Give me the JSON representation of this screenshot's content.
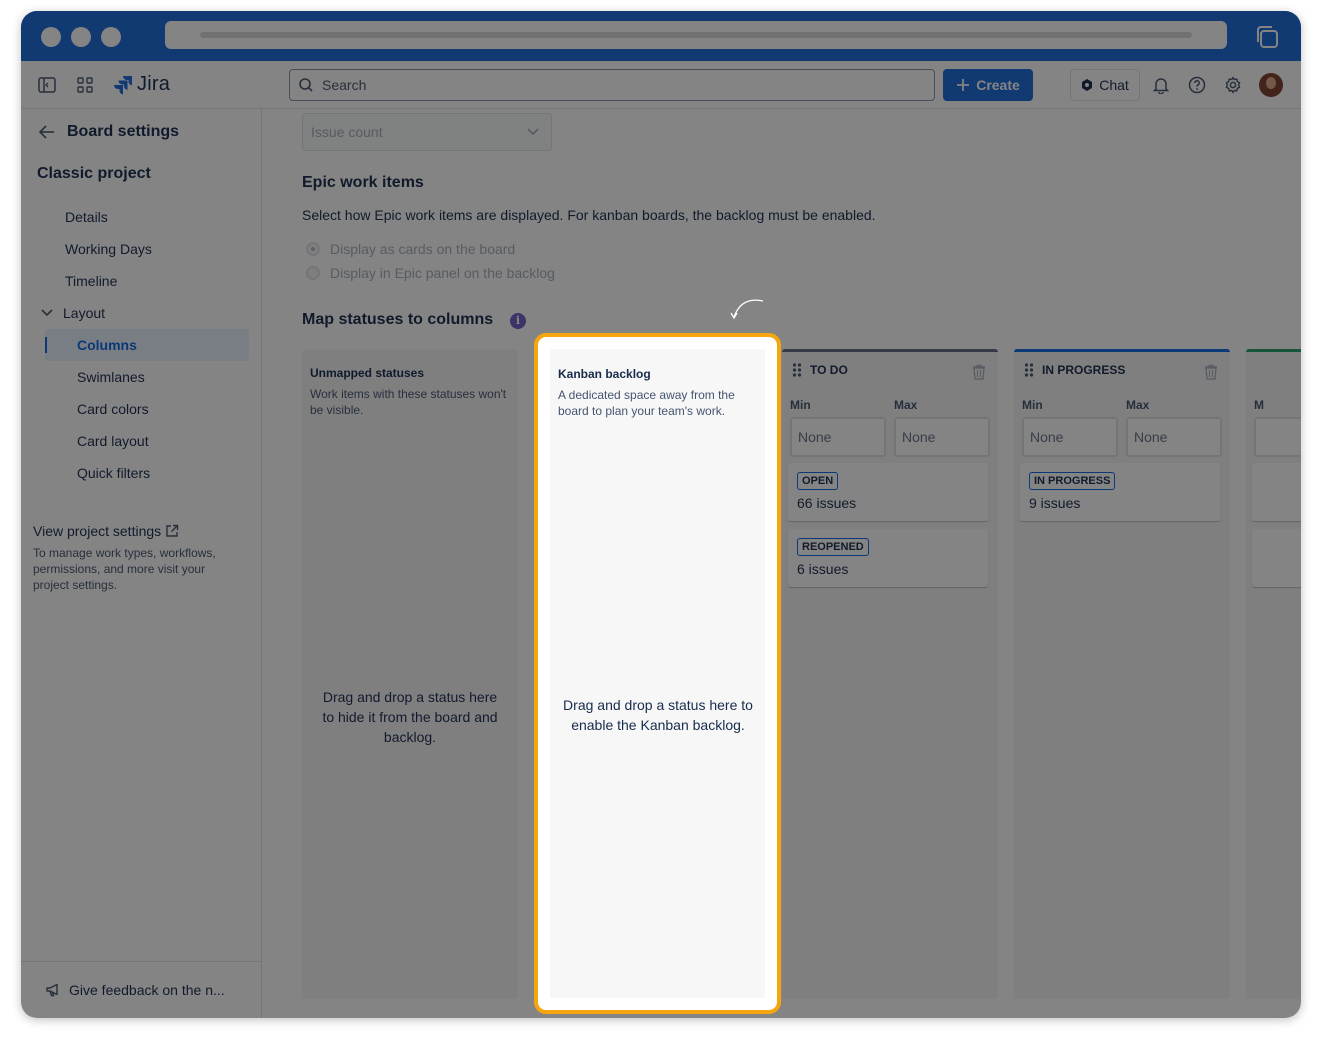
{
  "app": {
    "name": "Jira"
  },
  "topnav": {
    "search_placeholder": "Search",
    "create_label": "Create",
    "chat_label": "Chat"
  },
  "sidebar": {
    "back_label": "Board settings",
    "project_name": "Classic project",
    "items": [
      {
        "label": "Details"
      },
      {
        "label": "Working Days"
      },
      {
        "label": "Timeline"
      },
      {
        "label": "Layout"
      },
      {
        "label": "Columns"
      },
      {
        "label": "Swimlanes"
      },
      {
        "label": "Card colors"
      },
      {
        "label": "Card layout"
      },
      {
        "label": "Quick filters"
      }
    ],
    "view_settings_label": "View project settings",
    "view_settings_desc": "To manage work types, workflows, permissions, and more visit your project settings.",
    "feedback_label": "Give feedback on the n..."
  },
  "main": {
    "select_value": "Issue count",
    "epic_title": "Epic work items",
    "epic_desc": "Select how Epic work items are displayed. For kanban boards, the backlog must be enabled.",
    "radio_options": [
      {
        "label": "Display as cards on the board",
        "selected": true
      },
      {
        "label": "Display in Epic panel on the backlog",
        "selected": false
      }
    ],
    "map_title": "Map statuses to columns",
    "info_glyph": "i",
    "unmapped": {
      "title": "Unmapped statuses",
      "desc": "Work items with these statuses won't be visible.",
      "hint": "Drag and drop a status here to hide it from the board and backlog."
    },
    "kanban": {
      "title": "Kanban backlog",
      "desc": "A dedicated space away from the board to plan your team's work.",
      "hint": "Drag and drop a status here to enable the Kanban backlog."
    },
    "min_label": "Min",
    "max_label": "Max",
    "columns": [
      {
        "name": "TO DO",
        "color": "#5e6c84",
        "min": "None",
        "max": "None",
        "statuses": [
          {
            "name": "OPEN",
            "count": "66 issues"
          },
          {
            "name": "REOPENED",
            "count": "6 issues"
          }
        ]
      },
      {
        "name": "IN PROGRESS",
        "color": "#0c66e4",
        "min": "None",
        "max": "None",
        "statuses": [
          {
            "name": "IN PROGRESS",
            "count": "9 issues"
          }
        ]
      },
      {
        "name": "",
        "color": "#22a06b",
        "min_label_short": "M",
        "min": "",
        "max": "",
        "statuses": [
          {
            "name": "",
            "count": ""
          }
        ]
      }
    ]
  },
  "colors": {
    "chrome": "#1868db",
    "highlight": "#f5a50d",
    "accent": "#0c66e4"
  }
}
